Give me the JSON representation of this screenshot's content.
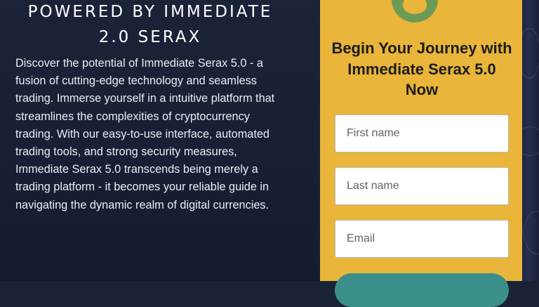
{
  "hero": {
    "title_line1": "POWERED BY IMMEDIATE",
    "title_line2": "2.0 SERAX",
    "description": "Discover the potential of Immediate Serax 5.0 - a fusion of cutting-edge technology and seamless trading. Immerse yourself in a intuitive platform that streamlines the complexities of cryptocurrency trading. With our easy-to-use interface, automated trading tools, and strong security measures, Immediate Serax 5.0 transcends being merely a trading platform - it becomes your reliable guide in navigating the dynamic realm of digital currencies."
  },
  "signup": {
    "title": "Begin Your Journey with Immediate Serax 5.0 Now",
    "first_name": {
      "placeholder": "First name",
      "value": ""
    },
    "last_name": {
      "placeholder": "Last name",
      "value": ""
    },
    "email": {
      "placeholder": "Email",
      "value": ""
    },
    "submit_label": "",
    "avatar_icon": "avatar-face-icon"
  },
  "colors": {
    "background": "#1a2238",
    "card": "#e9b53a",
    "avatar": "#6c9a54",
    "button": "#3a8f8a",
    "title_text": "#1c1c1c",
    "body_text": "#e8ecf4"
  }
}
